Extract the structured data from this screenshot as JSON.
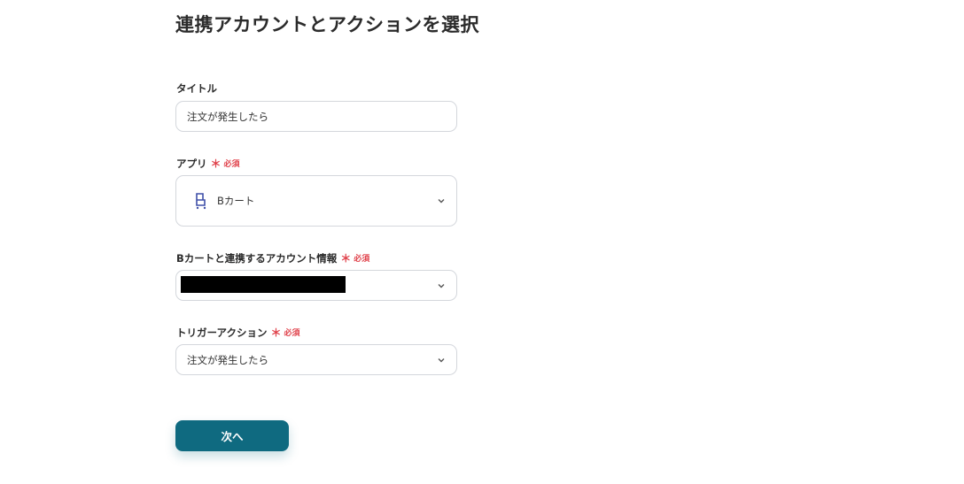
{
  "header": {
    "title": "連携アカウントとアクションを選択"
  },
  "form": {
    "required_mark": "＊",
    "required_text": "必須",
    "title_field": {
      "label": "タイトル",
      "value": "注文が発生したら"
    },
    "app_field": {
      "label": "アプリ",
      "value": "Bカート",
      "icon": "bcart-logo-icon"
    },
    "account_field": {
      "label": "Bカートと連携するアカウント情報",
      "value_redacted": true
    },
    "trigger_field": {
      "label": "トリガーアクション",
      "value": "注文が発生したら"
    }
  },
  "actions": {
    "next_label": "次へ"
  },
  "colors": {
    "accent": "#0f6a80",
    "required": "#e0424b",
    "border": "#d4d7dc"
  }
}
